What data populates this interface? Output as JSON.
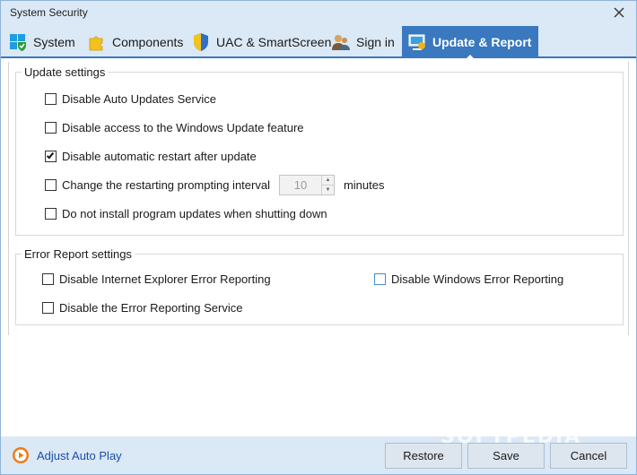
{
  "window": {
    "title": "System Security"
  },
  "tabs": [
    {
      "label": "System",
      "icon": "windows-shield-icon"
    },
    {
      "label": "Components",
      "icon": "puzzle-icon"
    },
    {
      "label": "UAC & SmartScreen",
      "icon": "uac-shield-icon"
    },
    {
      "label": "Sign in",
      "icon": "users-key-icon"
    },
    {
      "label": "Update & Report",
      "icon": "update-report-icon",
      "active": true
    }
  ],
  "update_settings": {
    "legend": "Update settings",
    "options": [
      {
        "label": "Disable Auto Updates Service",
        "checked": false
      },
      {
        "label": "Disable access to the Windows Update feature",
        "checked": false
      },
      {
        "label": "Disable automatic restart after update",
        "checked": true
      },
      {
        "label": "Change the restarting prompting interval",
        "checked": false
      },
      {
        "label": "Do not install program updates when shutting down",
        "checked": false
      }
    ],
    "interval_value": "10",
    "interval_unit": "minutes"
  },
  "error_settings": {
    "legend": "Error Report settings",
    "options": [
      {
        "label": "Disable Internet Explorer Error Reporting",
        "checked": false
      },
      {
        "label": "Disable Windows Error Reporting",
        "checked": false
      },
      {
        "label": "Disable the Error Reporting Service",
        "checked": false
      }
    ]
  },
  "footer": {
    "autoplay_label": "Adjust Auto Play",
    "restore_label": "Restore",
    "save_label": "Save",
    "cancel_label": "Cancel"
  },
  "watermark": "SOFTPEDIA",
  "colors": {
    "accent": "#3a78bf",
    "chrome": "#dbe8f5",
    "link": "#1a4fa8"
  }
}
